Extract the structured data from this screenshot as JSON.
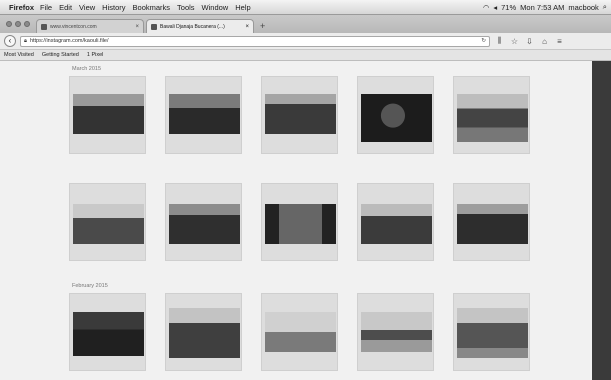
{
  "menubar": {
    "app": "Firefox",
    "items": [
      "File",
      "Edit",
      "View",
      "History",
      "Bookmarks",
      "Tools",
      "Window",
      "Help"
    ],
    "status": "Mon 7:53 AM",
    "user": "macbook",
    "battery": "71%"
  },
  "tabs": [
    {
      "label": "www.vincentcon.com"
    },
    {
      "label": "Bawali Djanaja Bucanera (...)"
    }
  ],
  "url": "https://instagram.com/kaouli.file/",
  "bookmarks": [
    "Most Visited",
    "Getting Started",
    "1 Pixel"
  ],
  "sections": [
    {
      "title": "March 2015"
    },
    {
      "title": "February 2015"
    }
  ],
  "icons": {
    "back": "back-arrow-icon",
    "lock": "lock-icon",
    "reload": "reload-icon"
  }
}
